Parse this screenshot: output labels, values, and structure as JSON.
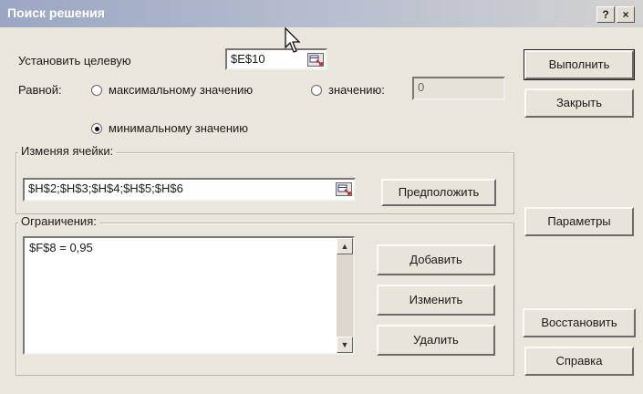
{
  "dialog": {
    "title": "Поиск решения",
    "help_label": "?",
    "close_label": "×"
  },
  "target": {
    "label": "Установить целевую",
    "value": "$E$10"
  },
  "equal": {
    "label": "Равной:",
    "max_label": "максимальному значению",
    "value_label": "значению:",
    "value_input": "0",
    "min_label": "минимальному значению",
    "selected": "min"
  },
  "changing": {
    "group_label": "Изменяя ячейки:",
    "value": "$H$2;$H$3;$H$4;$H$5;$H$6",
    "guess_button": "Предположить"
  },
  "constraints": {
    "group_label": "Ограничения:",
    "items": [
      "$F$8 = 0,95"
    ],
    "add_button": "Добавить",
    "change_button": "Изменить",
    "delete_button": "Удалить"
  },
  "buttons": {
    "solve": "Выполнить",
    "close": "Закрыть",
    "options": "Параметры",
    "reset": "Восстановить",
    "help": "Справка"
  },
  "icons": {
    "range_ref": "range-select-icon",
    "scroll_up": "scroll-up-icon",
    "scroll_down": "scroll-down-icon",
    "cursor": "mouse-cursor-icon"
  }
}
